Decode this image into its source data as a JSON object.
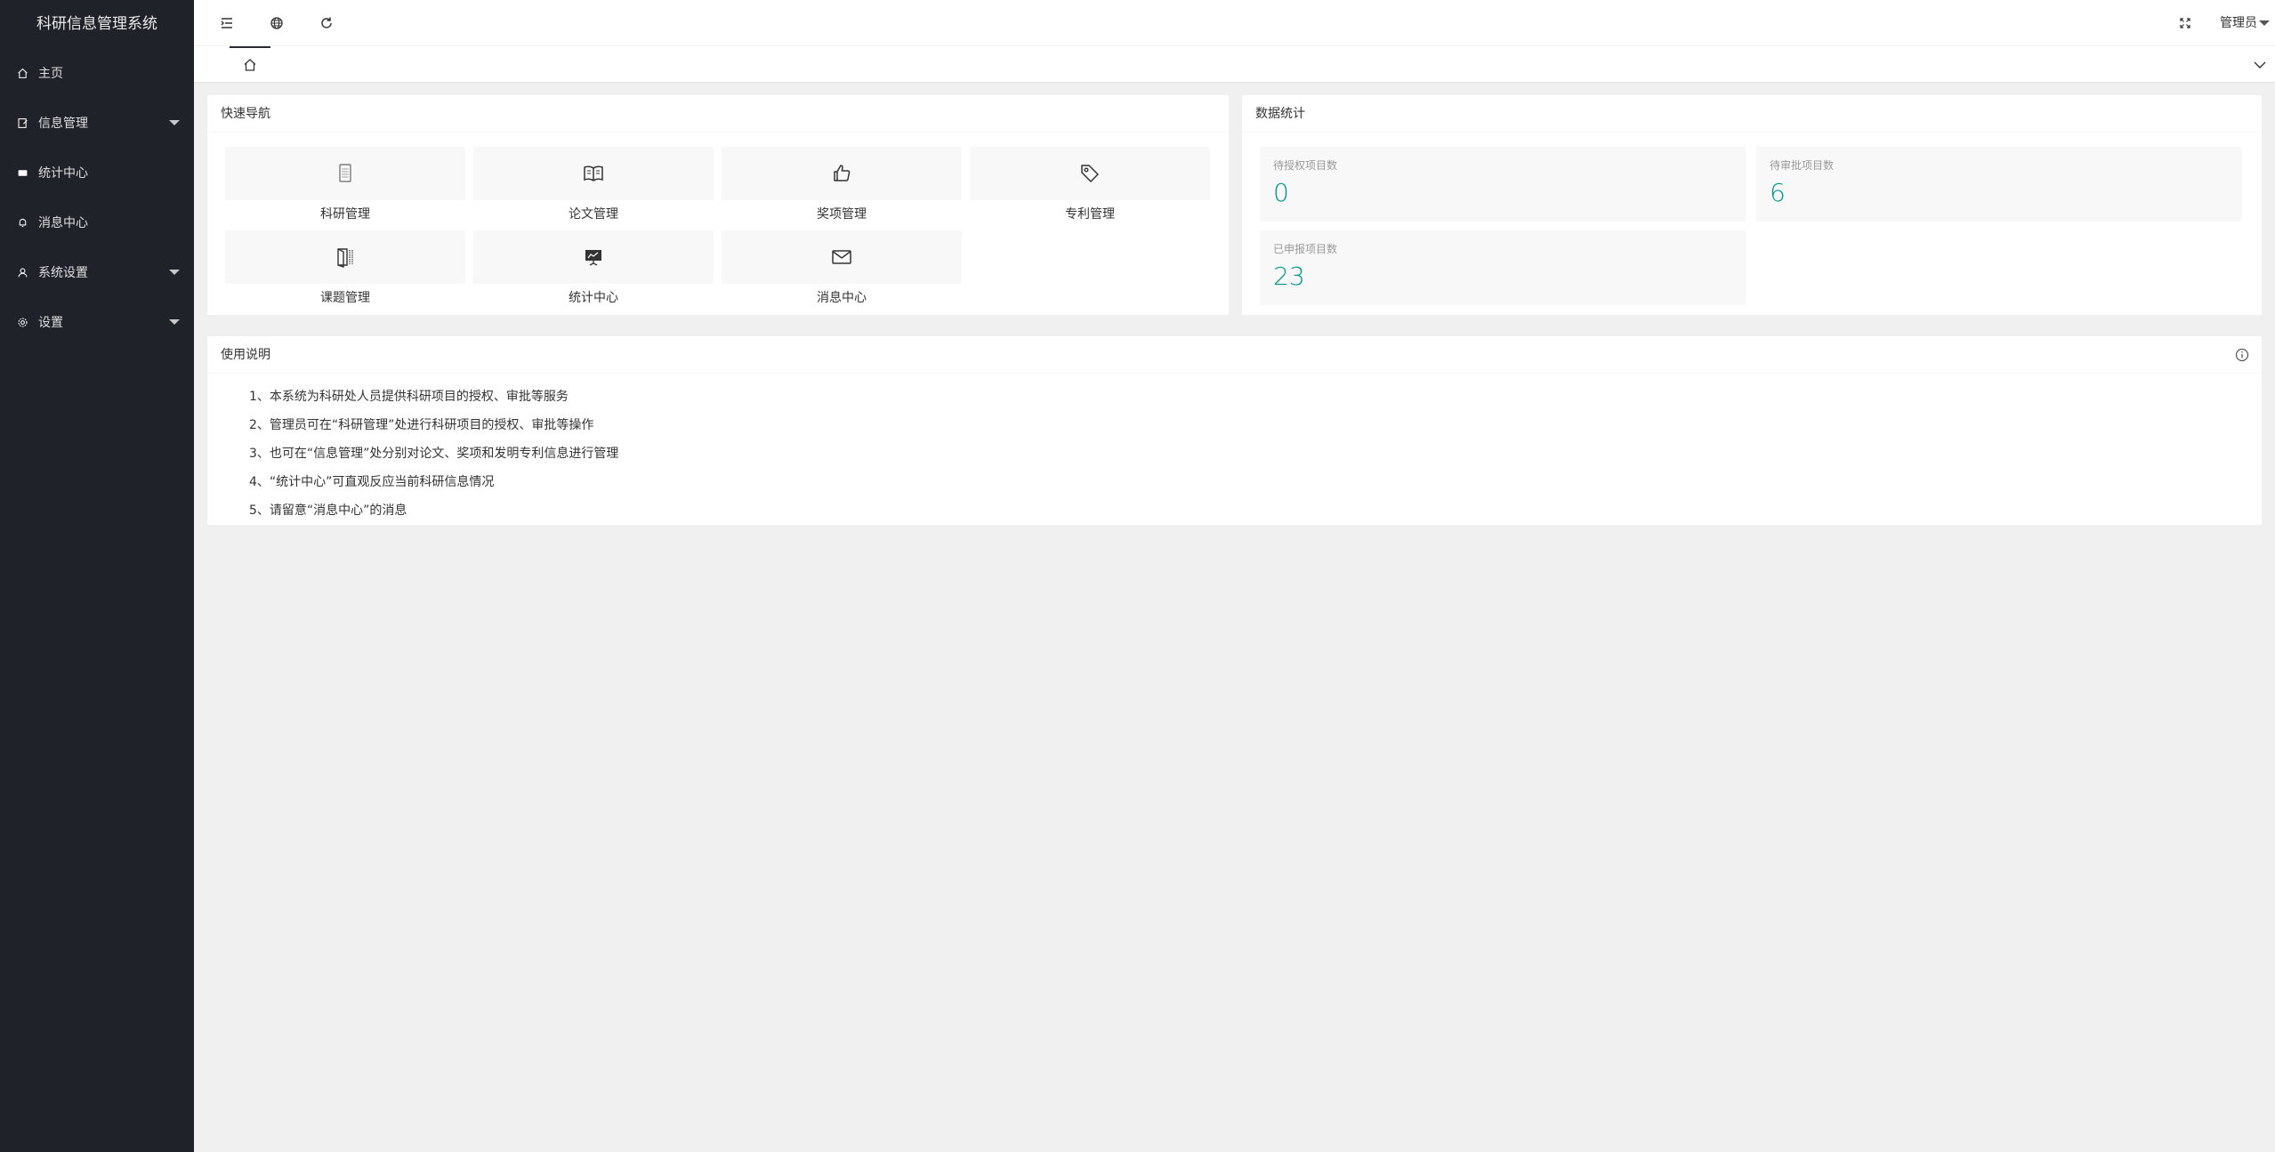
{
  "app": {
    "title": "科研信息管理系统"
  },
  "sidebar": {
    "items": [
      {
        "label": "主页",
        "icon": "home-icon",
        "has_sub": false
      },
      {
        "label": "信息管理",
        "icon": "edit-icon",
        "has_sub": true
      },
      {
        "label": "统计中心",
        "icon": "chart-icon",
        "has_sub": false
      },
      {
        "label": "消息中心",
        "icon": "bell-icon",
        "has_sub": false
      },
      {
        "label": "系统设置",
        "icon": "user-icon",
        "has_sub": true
      },
      {
        "label": "设置",
        "icon": "gear-icon",
        "has_sub": true
      }
    ]
  },
  "header": {
    "icons": [
      "menu-fold-icon",
      "globe-icon",
      "refresh-icon",
      "fullscreen-icon"
    ],
    "user_label": "管理员"
  },
  "tabs": {
    "home_icon": "home-icon",
    "more_icon": "chevron-down-icon"
  },
  "quick_nav": {
    "title": "快速导航",
    "items": [
      {
        "label": "科研管理",
        "icon": "document-list-icon"
      },
      {
        "label": "论文管理",
        "icon": "open-book-icon"
      },
      {
        "label": "奖项管理",
        "icon": "thumbs-up-icon"
      },
      {
        "label": "专利管理",
        "icon": "tag-icon"
      },
      {
        "label": "课题管理",
        "icon": "door-panel-icon"
      },
      {
        "label": "统计中心",
        "icon": "presentation-icon"
      },
      {
        "label": "消息中心",
        "icon": "envelope-icon"
      }
    ]
  },
  "stats": {
    "title": "数据统计",
    "items": [
      {
        "label": "待授权项目数",
        "value": "0"
      },
      {
        "label": "待审批项目数",
        "value": "6"
      },
      {
        "label": "已申报项目数",
        "value": "23"
      }
    ]
  },
  "guide": {
    "title": "使用说明",
    "items": [
      "1、本系统为科研处人员提供科研项目的授权、审批等服务",
      "2、管理员可在“科研管理”处进行科研项目的授权、审批等操作",
      "3、也可在“信息管理”处分别对论文、奖项和发明专利信息进行管理",
      "4、“统计中心”可直观反应当前科研信息情况",
      "5、请留意“消息中心”的消息"
    ]
  },
  "colors": {
    "sidebar_bg": "#20222a",
    "accent": "#009688",
    "page_bg": "#f0f0f0"
  }
}
